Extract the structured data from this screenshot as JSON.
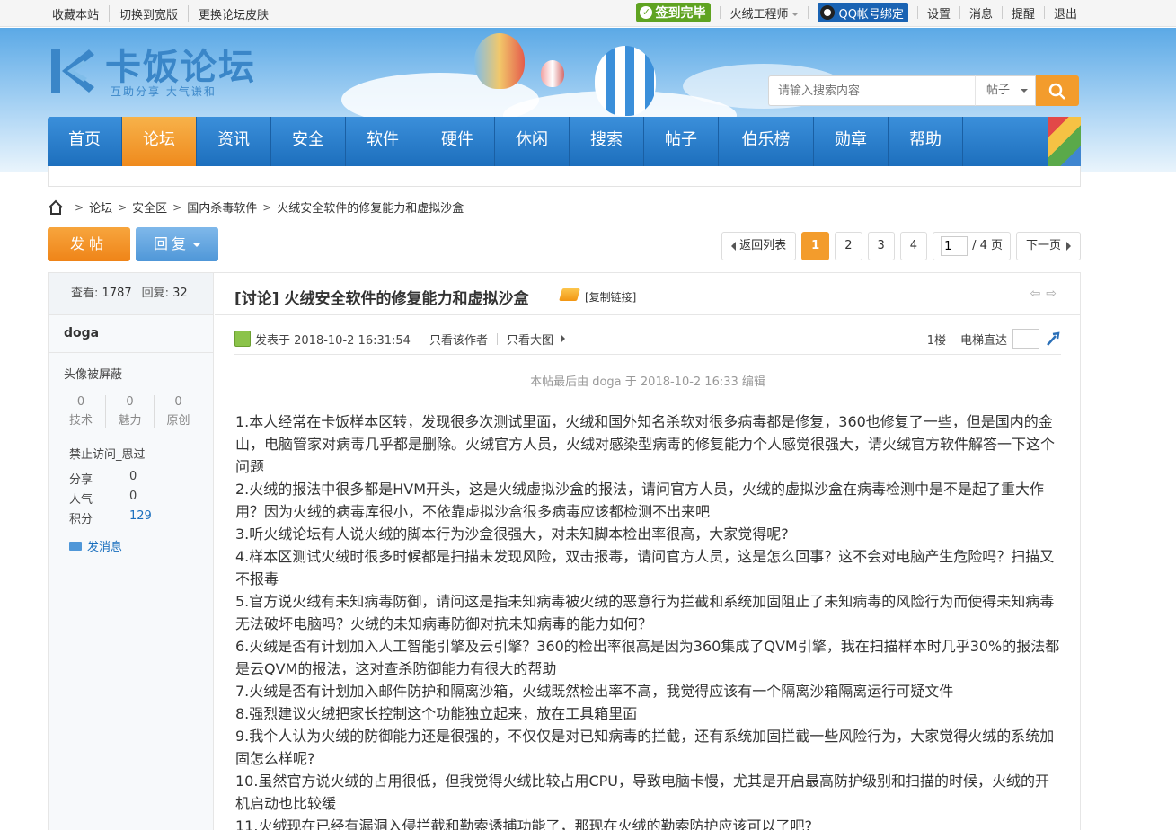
{
  "topbar": {
    "links": [
      "收藏本站",
      "切换到宽版",
      "更换论坛皮肤"
    ],
    "signin_label": "签到完毕",
    "username": "火绒工程师",
    "qq_bind": "QQ帐号绑定",
    "menu": [
      "设置",
      "消息",
      "提醒",
      "退出"
    ]
  },
  "header": {
    "logo_name": "卡饭论坛",
    "logo_slogan": "互助分享 大气谦和",
    "search_placeholder": "请输入搜索内容",
    "search_type": "帖子"
  },
  "nav": {
    "items": [
      "首页",
      "论坛",
      "资讯",
      "安全",
      "软件",
      "硬件",
      "休闲",
      "搜索",
      "帖子",
      "伯乐榜",
      "勋章",
      "帮助"
    ],
    "active_index": 1
  },
  "breadcrumb": [
    "论坛",
    "安全区",
    "国内杀毒软件",
    "火绒安全软件的修复能力和虚拟沙盒"
  ],
  "actions": {
    "post_label": "发帖",
    "reply_label": "回复"
  },
  "pager": {
    "back_label": "返回列表",
    "pages": [
      "1",
      "2",
      "3",
      "4"
    ],
    "current": "1",
    "jump_value": "1",
    "total_label": "/ 4 页",
    "next_label": "下一页"
  },
  "sidebar": {
    "views_label": "查看:",
    "views": "1787",
    "replies_label": "回复:",
    "replies": "32",
    "author": "doga",
    "avatar_notice": "头像被屏蔽",
    "stats": [
      {
        "value": "0",
        "label": "技术"
      },
      {
        "value": "0",
        "label": "魅力"
      },
      {
        "value": "0",
        "label": "原创"
      }
    ],
    "group": "禁止访问_思过",
    "details": [
      {
        "key": "分享",
        "value": "0"
      },
      {
        "key": "人气",
        "value": "0"
      },
      {
        "key": "积分",
        "value": "129"
      }
    ],
    "send_message": "发消息"
  },
  "post": {
    "title": "[讨论] 火绒安全软件的修复能力和虚拟沙盒",
    "copy_link": "[复制链接]",
    "posted_at": "发表于 2018-10-2 16:31:54",
    "only_author": "只看该作者",
    "view_big": "只看大图",
    "floor": "1楼",
    "jump_floor_label": "电梯直达",
    "edited_note": "本帖最后由 doga 于 2018-10-2 16:33 编辑",
    "paragraphs": [
      "1.本人经常在卡饭样本区转，发现很多次测试里面，火绒和国外知名杀软对很多病毒都是修复，360也修复了一些，但是国内的金山，电脑管家对病毒几乎都是删除。火绒官方人员，火绒对感染型病毒的修复能力个人感觉很强大，请火绒官方软件解答一下这个问题",
      "2.火绒的报法中很多都是HVM开头，这是火绒虚拟沙盒的报法，请问官方人员，火绒的虚拟沙盒在病毒检测中是不是起了重大作用？因为火绒的病毒库很小，不依靠虚拟沙盒很多病毒应该都检测不出来吧",
      "3.听火绒论坛有人说火绒的脚本行为沙盒很强大，对未知脚本检出率很高，大家觉得呢?",
      "4.样本区测试火绒时很多时候都是扫描未发现风险，双击报毒，请问官方人员，这是怎么回事？这不会对电脑产生危险吗？扫描又不报毒",
      "5.官方说火绒有未知病毒防御，请问这是指未知病毒被火绒的恶意行为拦截和系统加固阻止了未知病毒的风险行为而使得未知病毒无法破坏电脑吗？火绒的未知病毒防御对抗未知病毒的能力如何？",
      "6.火绒是否有计划加入人工智能引擎及云引擎？360的检出率很高是因为360集成了QVM引擎，我在扫描样本时几乎30%的报法都是云QVM的报法，这对查杀防御能力有很大的帮助",
      "7.火绒是否有计划加入邮件防护和隔离沙箱，火绒既然检出率不高，我觉得应该有一个隔离沙箱隔离运行可疑文件",
      "8.强烈建议火绒把家长控制这个功能独立起来，放在工具箱里面",
      "9.我个人认为火绒的防御能力还是很强的，不仅仅是对已知病毒的拦截，还有系统加固拦截一些风险行为，大家觉得火绒的系统加固怎么样呢?",
      "10.虽然官方说火绒的占用很低，但我觉得火绒比较占用CPU，导致电脑卡慢，尤其是开启最高防护级别和扫描的时候，火绒的开机启动也比较缓",
      "11.火绒现在已经有漏洞入侵拦截和勒索诱捕功能了，那现在火绒的勒索防护应该可以了吧?"
    ]
  }
}
